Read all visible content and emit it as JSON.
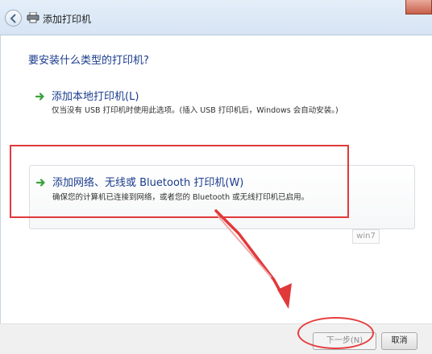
{
  "window": {
    "title": "添加打印机"
  },
  "main": {
    "heading": "要安装什么类型的打印机?",
    "options": [
      {
        "title": "添加本地打印机(L)",
        "description": "仅当没有 USB 打印机时使用此选项。(插入 USB 打印机后，Windows 会自动安装。)"
      },
      {
        "title": "添加网络、无线或 Bluetooth 打印机(W)",
        "description": "确保您的计算机已连接到网络，或者您的 Bluetooth 或无线打印机已启用。"
      }
    ]
  },
  "watermark": "win7",
  "footer": {
    "next_label": "下一步(N)",
    "cancel_label": "取消"
  },
  "colors": {
    "heading": "#1a3b8c",
    "annotation": "#e1393a",
    "option_arrow": "#3aa13a"
  }
}
